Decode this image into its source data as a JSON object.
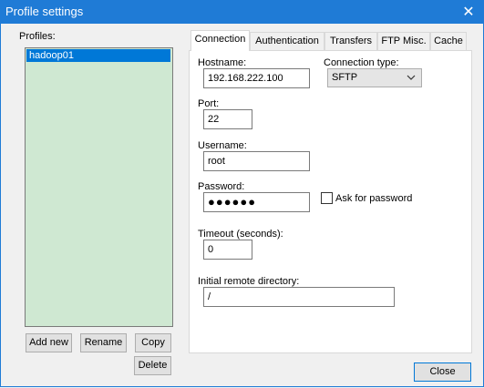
{
  "window": {
    "title": "Profile settings"
  },
  "profiles": {
    "label": "Profiles:",
    "items": [
      "hadoop01"
    ],
    "buttons": {
      "add_new": "Add new",
      "rename": "Rename",
      "copy": "Copy",
      "delete": "Delete"
    }
  },
  "tabs": [
    "Connection",
    "Authentication",
    "Transfers",
    "FTP Misc.",
    "Cache"
  ],
  "connection": {
    "hostname_label": "Hostname:",
    "hostname_value": "192.168.222.100",
    "connection_type_label": "Connection type:",
    "connection_type_value": "SFTP",
    "port_label": "Port:",
    "port_value": "22",
    "username_label": "Username:",
    "username_value": "root",
    "password_label": "Password:",
    "password_value": "●●●●●●",
    "ask_password_label": "Ask for password",
    "timeout_label": "Timeout (seconds):",
    "timeout_value": "0",
    "remote_dir_label": "Initial remote directory:",
    "remote_dir_value": "/"
  },
  "footer": {
    "close_label": "Close"
  },
  "icons": {
    "window_close": "close-icon",
    "dropdown": "chevron-down-icon"
  },
  "colors": {
    "titlebar": "#1f7bd6",
    "selection": "#0078d7",
    "list_bg": "#cfe8d2"
  }
}
